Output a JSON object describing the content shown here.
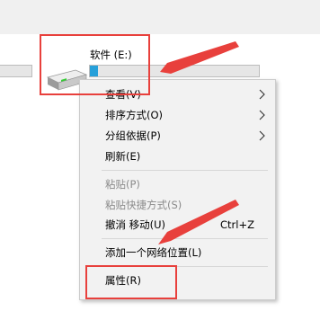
{
  "drive": {
    "label": "软件 (E:)",
    "usage_fraction": 0.05,
    "icon": "hard-drive-icon",
    "bar_color": "#26a0da"
  },
  "menu": {
    "items": [
      {
        "label": "查看(V)"
      },
      {
        "label": "排序方式(O)"
      },
      {
        "label": "分组依据(P)"
      },
      {
        "label": "刷新(E)"
      },
      {
        "label": "粘贴(P)"
      },
      {
        "label": "粘贴快捷方式(S)"
      },
      {
        "label": "撤消 移动(U)",
        "shortcut": "Ctrl+Z"
      },
      {
        "label": "添加一个网络位置(L)"
      },
      {
        "label": "属性(R)"
      }
    ]
  },
  "annotation": {
    "highlight_color": "#e8403c"
  }
}
